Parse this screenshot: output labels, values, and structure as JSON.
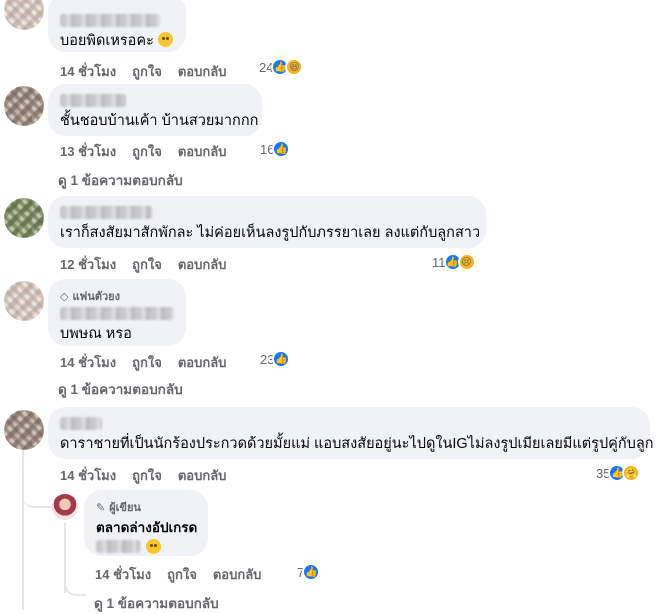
{
  "comments": [
    {
      "text": "บอยพิดเหรอคะ",
      "time": "14 ชั่วโมง",
      "like": "ถูกใจ",
      "reply": "ตอบกลับ",
      "reaction_count": "24",
      "reaction_icons": [
        "like",
        "haha"
      ]
    },
    {
      "text": "ชั้นชอบบ้านเค้า บ้านสวยมากกก",
      "time": "13 ชั่วโมง",
      "like": "ถูกใจ",
      "reply": "ตอบกลับ",
      "reaction_count": "16",
      "reaction_icons": [
        "like"
      ],
      "view_replies": "ดู 1 ข้อความตอบกลับ"
    },
    {
      "text": "เราก็สงสัยมาสักพักละ ไม่ค่อยเห็นลงรูปกับภรรยาเลย ลงแต่กับลูกสาว",
      "time": "12 ชั่วโมง",
      "like": "ถูกใจ",
      "reply": "ตอบกลับ",
      "reaction_count": "11",
      "reaction_icons": [
        "like",
        "sad"
      ]
    },
    {
      "badge": "แฟนตัวยง",
      "text": "บพษณ หรอ",
      "time": "14 ชั่วโมง",
      "like": "ถูกใจ",
      "reply": "ตอบกลับ",
      "reaction_count": "23",
      "reaction_icons": [
        "like"
      ],
      "view_replies": "ดู 1 ข้อความตอบกลับ"
    },
    {
      "text": "ดาราชายที่เป็นนักร้องประกวดด้วยมั้ยแม่ แอบสงสัยอยู่นะไปดูในIGไม่ลงรูปเมียเลยมีแต่รูปคู่กับลูก",
      "time": "14 ชั่วโมง",
      "like": "ถูกใจ",
      "reply": "ตอบกลับ",
      "reaction_count": "35",
      "reaction_icons": [
        "like",
        "care"
      ]
    }
  ],
  "author_reply": {
    "badge": "ผู้เขียน",
    "name": "ตลาดล่างอัปเกรด",
    "time": "14 ชั่วโมง",
    "like": "ถูกใจ",
    "reply": "ตอบกลับ",
    "reaction_count": "7",
    "reaction_icons": [
      "like"
    ],
    "view_replies": "ดู 1 ข้อความตอบกลับ"
  },
  "colors": {
    "bubble": "#f0f2f5",
    "meta_text": "#65676b",
    "like_blue": "#1877f2",
    "emoji_yellow": "#f7b125"
  }
}
